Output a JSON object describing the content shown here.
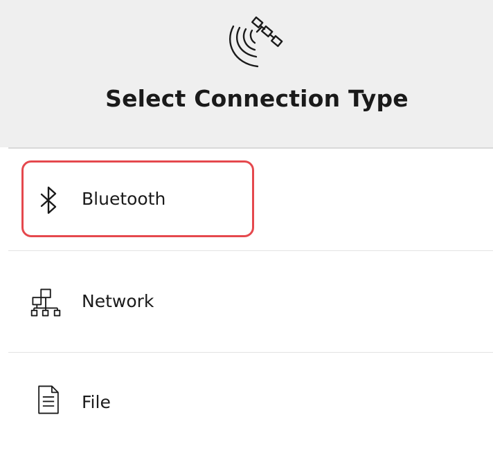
{
  "header": {
    "icon": "satellite-icon",
    "title": "Select Connection Type"
  },
  "options": [
    {
      "label": "Bluetooth",
      "icon": "bluetooth-icon",
      "selected": true
    },
    {
      "label": "Network",
      "icon": "network-icon",
      "selected": false
    },
    {
      "label": "File",
      "icon": "file-icon",
      "selected": false
    }
  ],
  "colors": {
    "header_bg": "#efefef",
    "highlight_border": "#e5484d",
    "divider": "#e2e2e2"
  }
}
